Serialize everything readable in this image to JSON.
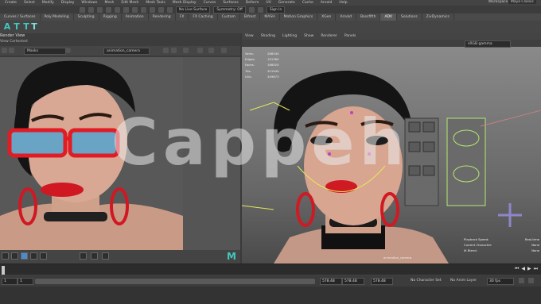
{
  "window": {
    "workspace_label": "Workspace:",
    "workspace_value": "Maya Classic"
  },
  "menus": [
    "Create",
    "Select",
    "Modify",
    "Display",
    "Windows",
    "Mesh",
    "Edit Mesh",
    "Mesh Tools",
    "Mesh Display",
    "Curves",
    "Surfaces",
    "Deform",
    "UV",
    "Generate",
    "Cache",
    "Arnold",
    "Help"
  ],
  "status_line": {
    "mode": "Rigging",
    "no_live_surface": "No Live Surface",
    "symmetry": "Symmetry: Off",
    "sign_in": "Sign In"
  },
  "shelf_tabs": [
    "Curves / Surfaces",
    "Poly Modeling",
    "Sculpting",
    "Rigging",
    "Animation",
    "Rendering",
    "FX",
    "FX Caching",
    "Custom",
    "Bifrost",
    "MASH",
    "Motion Graphics",
    "XGen",
    "Arnold",
    "Bossfifth",
    "ADV",
    "Solutions",
    "ZivDynamics"
  ],
  "shelf_active": "ADV",
  "render_view": {
    "title": "Render View",
    "menu": "View    Cortented",
    "layer": "Masks",
    "camera": "animation_camera"
  },
  "viewport": {
    "menu": [
      "View",
      "Shading",
      "Lighting",
      "Show",
      "Renderer",
      "Panels"
    ],
    "camera_combo": "sRGB gamma",
    "hud_labels": [
      "Verts:",
      "Edges:",
      "Faces:",
      "Tris:",
      "UVs:"
    ],
    "hud_values": [
      "286340",
      "191380",
      "168920",
      "301940",
      "349673"
    ],
    "hud_right": [
      {
        "label": "Playback Speed:",
        "value": "Real-time"
      },
      {
        "label": "Current Character:",
        "value": "None"
      },
      {
        "label": "IK Blend:",
        "value": "None"
      }
    ],
    "camera_label": "animation_camera"
  },
  "timeline": {
    "ticks": [
      "5",
      "10",
      "15",
      "20",
      "25",
      "30",
      "35",
      "40",
      "45",
      "50",
      "55",
      "60",
      "65",
      "70",
      "75",
      "80",
      "85",
      "90",
      "95",
      "100",
      "105",
      "110",
      "115",
      "120",
      "125",
      "130",
      "135",
      "140",
      "145",
      "150",
      "155",
      "160",
      "165",
      "170",
      "175",
      "180",
      "185",
      "190",
      "195",
      "200"
    ],
    "current_frame": "1"
  },
  "range": {
    "start": "1",
    "inner_start": "1",
    "inner_end": "578.48",
    "end": "578.48",
    "end2": "578.48",
    "character": "No Character Set",
    "anim_layer": "No Anim Layer",
    "fps": "30 fps"
  },
  "watermark": "Cappeh"
}
